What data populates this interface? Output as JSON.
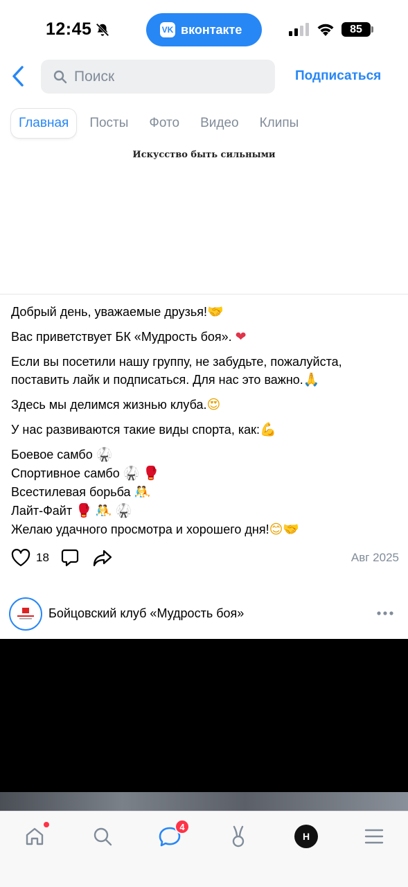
{
  "status_bar": {
    "time": "12:45",
    "app_pill": "вконтакте",
    "app_pill_logo": "VK",
    "battery": "85"
  },
  "header": {
    "search_placeholder": "Поиск",
    "subscribe_label": "Подписаться"
  },
  "tabs": [
    {
      "label": "Главная",
      "active": true
    },
    {
      "label": "Посты",
      "active": false
    },
    {
      "label": "Фото",
      "active": false
    },
    {
      "label": "Видео",
      "active": false
    },
    {
      "label": "Клипы",
      "active": false
    }
  ],
  "cover": {
    "caption": "Искусство быть сильными"
  },
  "post": {
    "p1": "Добрый день, уважаемые друзья!",
    "p2": "Вас приветствует БК «Мудрость боя».",
    "p3": "Если вы посетили нашу группу, не забудьте, пожалуйста, поставить лайк и подписаться. Для нас это важно.",
    "p4": "Здесь мы делимся жизнью клуба.",
    "p5": "У нас развиваются такие виды спорта, как:",
    "list": [
      "Боевое самбо",
      "Спортивное самбо",
      "Всестилевая борьба",
      "Лайт-Файт",
      "Желаю удачного просмотра и хорошего дня!"
    ],
    "likes": "18",
    "date": "Авг 2025"
  },
  "next_post": {
    "group_name": "Бойцовский клуб «Мудрость боя»"
  },
  "bottom_nav": {
    "messages_badge": "4",
    "profile_initial": "H"
  },
  "icons": {
    "back": "chevron-left-icon",
    "search": "search-icon",
    "like": "heart-icon",
    "comment": "comment-icon",
    "share": "share-icon",
    "more": "more-horizontal-icon"
  },
  "colors": {
    "accent": "#2787f5",
    "secondary_text": "#818c99",
    "badge": "#ff3347"
  }
}
